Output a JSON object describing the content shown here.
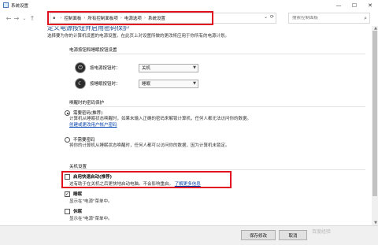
{
  "window": {
    "title": "系统设置",
    "controls": {
      "minimize": "—",
      "maximize": "☐",
      "close": "✕"
    }
  },
  "nav": {
    "back": "←",
    "forward": "→",
    "up": "↑",
    "breadcrumbs": [
      "控制面板",
      "所有控制面板项",
      "电源选项",
      "系统设置"
    ],
    "separator": "›",
    "refresh": "⟳",
    "search_placeholder": "搜索控制面板"
  },
  "page": {
    "heading": "定义电源按钮并启用密码保护",
    "description": "选择要为你的计算机设置的电源设置。在此页上对设置所做的更改将应用于你所有的电源计划。",
    "power_section": {
      "title": "电源按钮和睡眠按钮设置",
      "rows": [
        {
          "label": "按电源按钮时：",
          "value": "关机"
        },
        {
          "label": "按睡眠按钮时：",
          "value": "睡眠"
        }
      ]
    },
    "wake_section": {
      "title": "唤醒时的密码保护",
      "options": [
        {
          "label": "需要密码(推荐)",
          "selected": true,
          "desc": "计算机从睡眠状态唤醒时，如果未输入正确的密码来解锁计算机，任何人都无法访问你的数据。",
          "link": "创建或更改用户帐户密码"
        },
        {
          "label": "不需要密码",
          "selected": false,
          "desc": "将你的计算机从睡眠状态唤醒时，任何人都可以访问你的数据，因为计算机未锁定。"
        }
      ]
    },
    "shutdown_section": {
      "title": "关机设置",
      "items": [
        {
          "label": "启用快速启动(推荐)",
          "checked": false,
          "desc": "这有助于在关机之后更快地启动电脑。不会影响重启。",
          "link": "了解更多信息"
        },
        {
          "label": "睡眠",
          "checked": true,
          "desc": "显示在\"电源\"菜单中。"
        },
        {
          "label": "休眠",
          "checked": false,
          "desc": "显示在\"电源\"菜单中。"
        }
      ]
    }
  },
  "footer": {
    "save": "保存修改",
    "cancel": "取消",
    "watermark": "百度经验"
  },
  "colors": {
    "highlight": "#e0121f",
    "link": "#0645ad"
  }
}
